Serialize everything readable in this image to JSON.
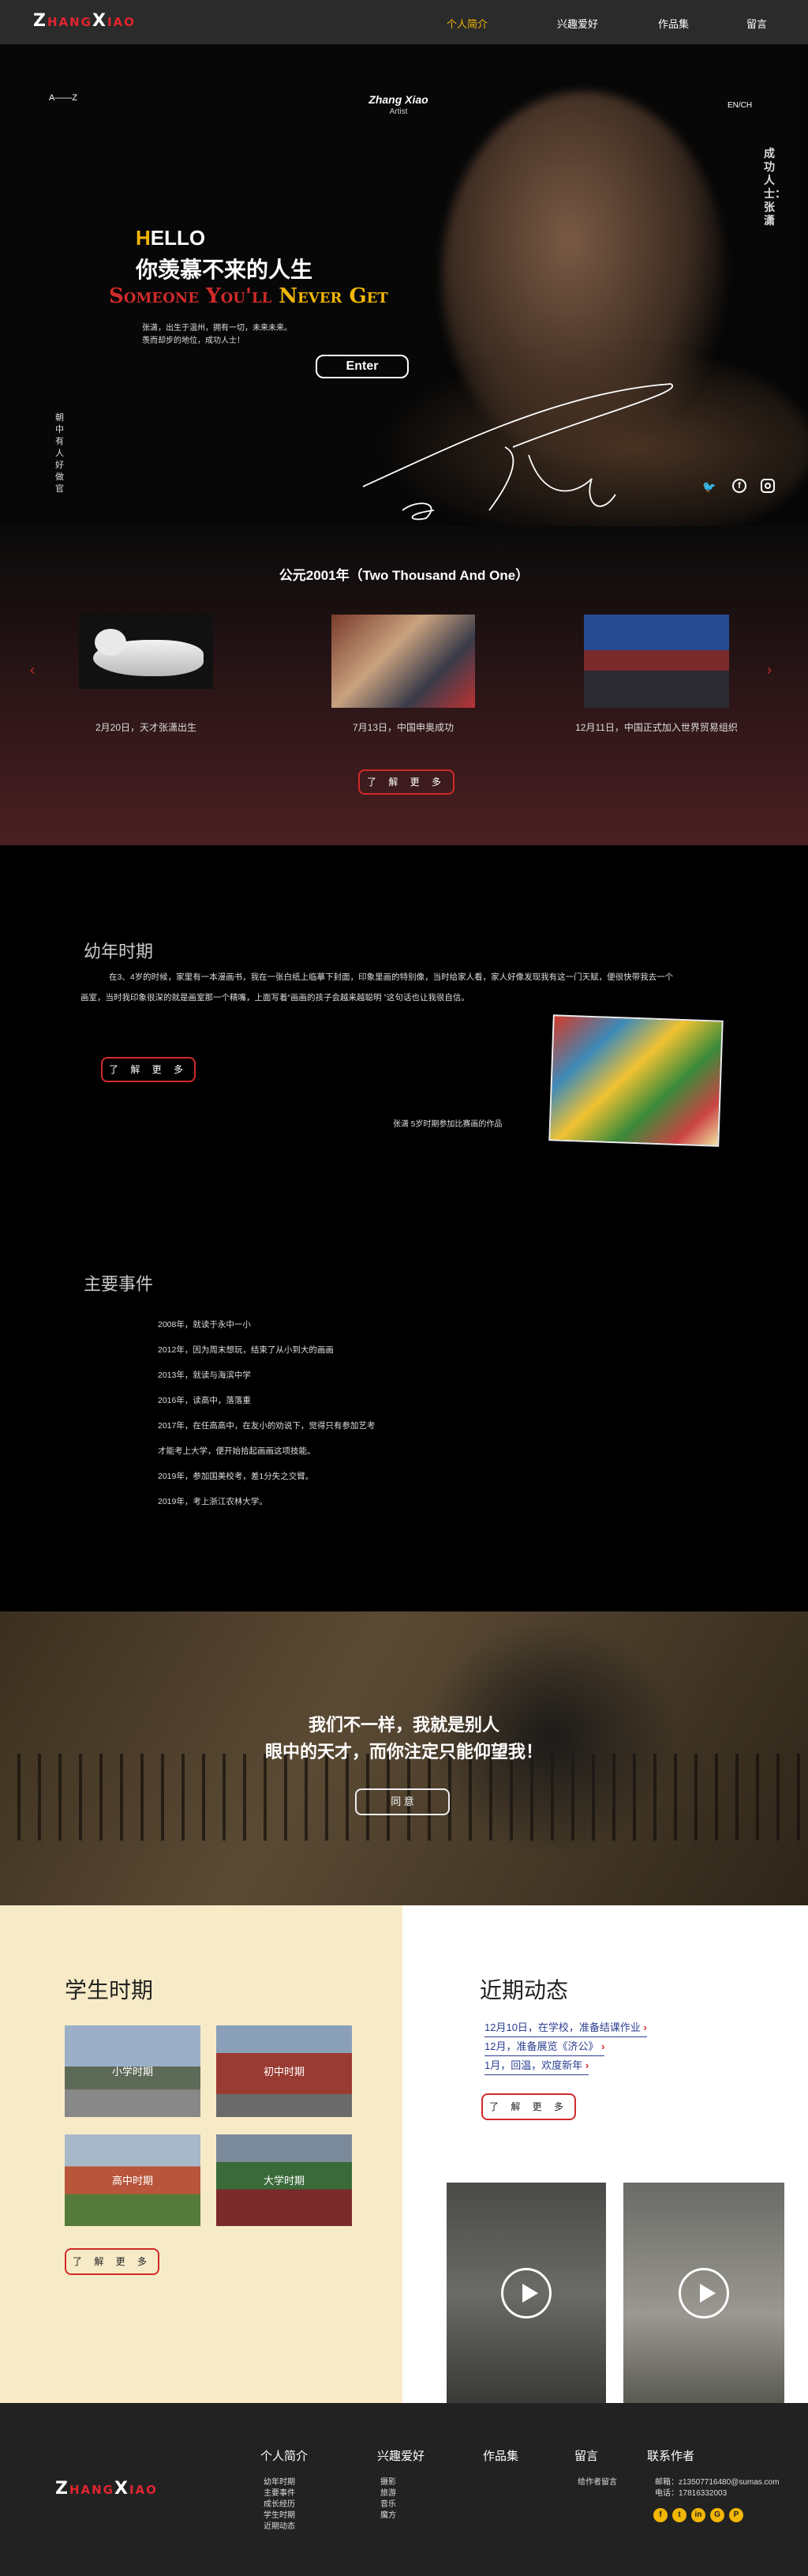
{
  "nav": {
    "logo": {
      "a": "Z",
      "b": "HANG",
      "c": "X",
      "d": "IAO"
    },
    "links": [
      "个人简介",
      "兴趣爱好",
      "作品集",
      "留言"
    ]
  },
  "hero": {
    "az": "A——Z",
    "artist_name": "Zhang  Xiao",
    "artist_role": "Artist",
    "lang": "EN/CH",
    "vertical_right": "成功人士：张潇",
    "vertical_left": "朝中有人好做官",
    "hello_h": "H",
    "hello_rest": "ELLO",
    "headline": "你羡慕不来的人生",
    "slogan": {
      "a": "Someone You",
      "b": "'ll ",
      "c": "Never Get"
    },
    "intro1": "张潇，出生于温州，拥有一切，未来未来。",
    "intro2": "羡而却步的地位，成功人士！",
    "enter": "Enter",
    "icons": [
      "twitter-icon",
      "facebook-icon",
      "instagram-icon"
    ]
  },
  "timeline": {
    "title": "公元2001年（Two Thousand And One）",
    "items": [
      {
        "caption": "2月20日，天才张潇出生"
      },
      {
        "caption": "7月13日，中国申奥成功"
      },
      {
        "caption": "12月11日，中国正式加入世界贸易组织"
      }
    ],
    "more": "了 解 更 多"
  },
  "childhood": {
    "title": "幼年时期",
    "para1": "在3、4岁的时候，家里有一本漫画书，我在一张白纸上临摹下封面，印象里画的特别像，当时给家人看，家人好像发现我有这一门天赋，便很快带我去一个",
    "para2": "画室，当时我印象很深的就是画室那一个精嘴，上面写着“画画的孩子会越来越聪明 ”这句话也让我很自信。",
    "more": "了 解 更 多",
    "art_caption": "张潇  5岁时期参加比赛画的作品"
  },
  "events": {
    "title": "主要事件",
    "list": [
      "2008年，就读于永中一小",
      "2012年，因为周末想玩，结束了从小到大的画画",
      "2013年，就读与海滨中学",
      "2016年，读高中，落落重",
      "2017年，在任高高中，在友小的劝说下，觉得只有参加艺考",
      "才能考上大学，便开始拾起画画这项技能。",
      "2019年，参加国美校考，差1分失之交臂。",
      "2019年，考上浙江农林大学。"
    ]
  },
  "banner": {
    "line1": "我们不一样，我就是别人",
    "line2": "眼中的天才，而你注定只能仰望我！",
    "button": "同    意"
  },
  "student": {
    "title": "学生时期",
    "tiles": [
      "小学时期",
      "初中时期",
      "高中时期",
      "大学时期"
    ],
    "more": "了 解 更 多"
  },
  "recent": {
    "title": "近期动态",
    "news": [
      "12月10日，在学校，准备结课作业",
      "12月，准备展览《济公》",
      "1月，回温，欢度新年"
    ],
    "more": "了 解 更 多"
  },
  "footer": {
    "logo": {
      "a": "Z",
      "b": "HANG",
      "c": "X",
      "d": "IAO"
    },
    "cols": [
      {
        "title": "个人简介",
        "items": [
          "幼年时期",
          "主要事件",
          "成长经历",
          "学生时期",
          "近期动态"
        ]
      },
      {
        "title": "兴趣爱好",
        "items": [
          "摄影",
          "旅游",
          "音乐",
          "魔方"
        ]
      },
      {
        "title": "作品集",
        "items": []
      },
      {
        "title": "留言",
        "items": [
          "给作者留言"
        ]
      },
      {
        "title": "联系作者",
        "items": [
          "邮箱：z13507716480@sumas.com",
          "电话：17816332003"
        ]
      }
    ],
    "social": [
      "facebook-icon",
      "twitter-icon",
      "linkedin-icon",
      "google-plus-icon",
      "pinterest-icon"
    ]
  },
  "colors": {
    "accent": "#f2b705",
    "red": "#d12a2a",
    "nav_bg": "#2b2b2b",
    "cream": "#f7ebc7",
    "news_blue": "#2b3f8f"
  }
}
